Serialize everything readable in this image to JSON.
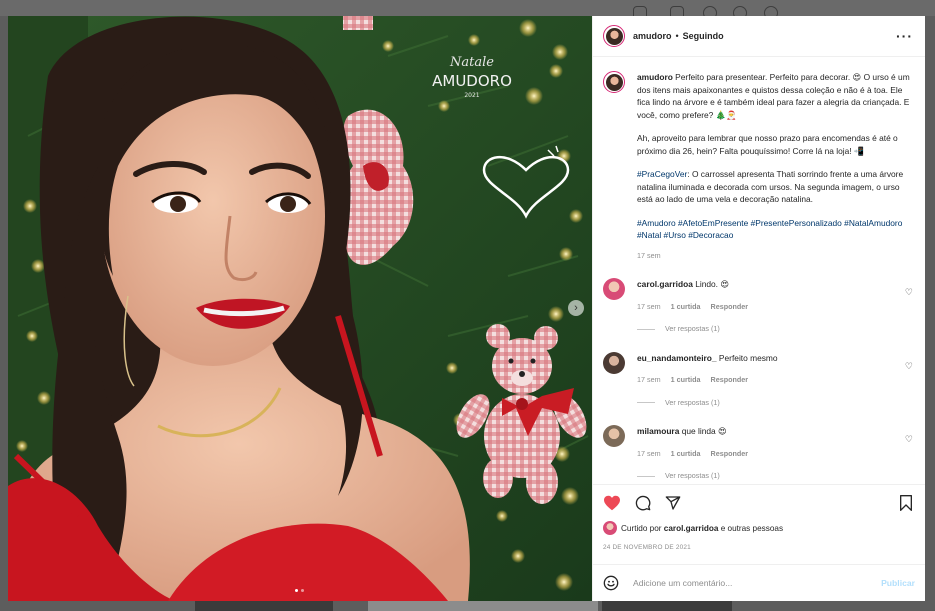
{
  "post": {
    "username": "amudoro",
    "separator": "•",
    "following_label": "Seguindo",
    "more_icon": "more-horizontal-icon",
    "media_watermark": {
      "script": "Natale",
      "brand": "AMUDORO",
      "year": "2021"
    }
  },
  "caption": {
    "username": "amudoro",
    "text1": "Perfeito para presentear. Perfeito para decorar. 😍 O urso é um dos itens mais apaixonantes e quistos dessa coleção e não é à toa. Ele fica lindo na árvore e é também ideal para fazer a alegria da criançada. E você, como prefere? 🎄🎅",
    "text2": "Ah, aproveito para lembrar que nosso prazo para encomendas é até o próximo dia 26, hein? Falta pouquíssimo! Corre lá na loja! 📲",
    "tag_pracegover": "#PraCegoVer",
    "text3": ": O carrossel apresenta Thati sorrindo frente a uma árvore natalina iluminada e decorada com ursos. Na segunda imagem, o urso está ao lado de uma vela e decoração natalina.",
    "hashtags": "#Amudoro #AfetoEmPresente #PresentePersonalizado #NatalAmudoro #Natal #Urso #Decoracao",
    "time": "17 sem"
  },
  "comments": [
    {
      "username": "carol.garridoa",
      "text": "Lindo. 😍",
      "time": "17 sem",
      "likes": "1 curtida",
      "reply": "Responder",
      "view_replies": "Ver respostas (1)"
    },
    {
      "username": "eu_nandamonteiro_",
      "text": "Perfeito mesmo",
      "time": "17 sem",
      "likes": "1 curtida",
      "reply": "Responder",
      "view_replies": "Ver respostas (1)"
    },
    {
      "username": "milamoura",
      "text": "que linda 😍",
      "time": "17 sem",
      "likes": "1 curtida",
      "reply": "Responder",
      "view_replies": "Ver respostas (1)"
    }
  ],
  "actions": {
    "liked_by_prefix": "Curtido por",
    "liked_by_user": "carol.garridoa",
    "liked_by_suffix": "e outras pessoas",
    "date": "24 DE NOVEMBRO DE 2021",
    "like_active": true
  },
  "composer": {
    "placeholder": "Adicione um comentário...",
    "publish_label": "Publicar"
  },
  "colors": {
    "like": "#ed4956",
    "link": "#00376b",
    "publish": "#b2dffc",
    "story_ring": "#d62976"
  },
  "carousel": {
    "slides": 2,
    "current": 1
  }
}
